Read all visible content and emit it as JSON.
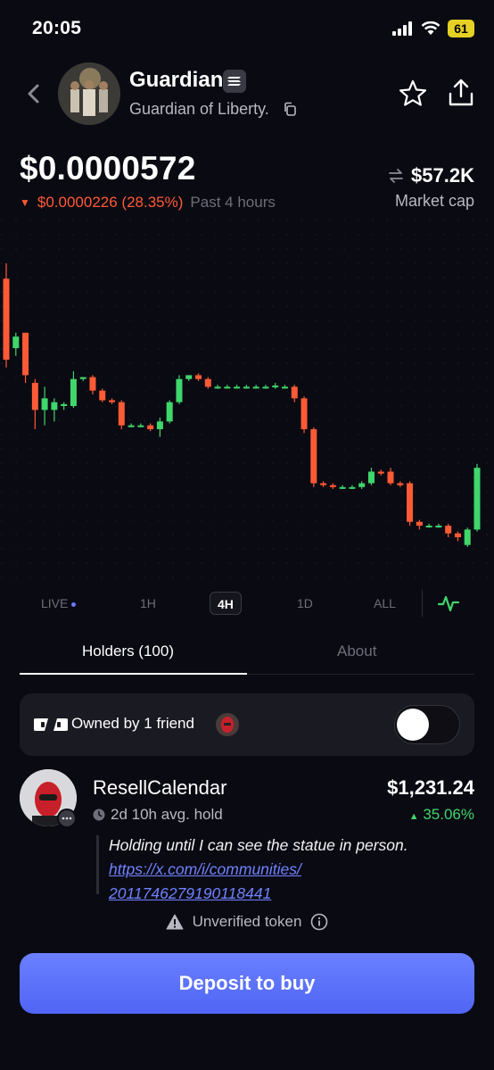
{
  "status_bar": {
    "time": "20:05",
    "battery": "61"
  },
  "token": {
    "name": "Guardian",
    "subtitle": "Guardian of Liberty.",
    "price": "$0.0000572",
    "change": "$0.0000226 (28.35%)",
    "period": "Past 4 hours",
    "market_cap": "$57.2K",
    "market_cap_label": "Market cap"
  },
  "timeframes": [
    "LIVE",
    "1H",
    "4H",
    "1D",
    "ALL"
  ],
  "active_timeframe": "4H",
  "tabs": {
    "holders": "Holders (100)",
    "about": "About"
  },
  "friends": {
    "label": "Owned by 1 friend",
    "toggle_on": false
  },
  "holder": {
    "name": "ResellCalendar",
    "value": "$1,231.24",
    "change": "35.06%",
    "hold": "2d 10h avg. hold",
    "quote": "Holding until I can see the statue in person.",
    "link_line1": "https://x.com/i/communities/",
    "link_line2": "2011746279190118441"
  },
  "unverified_label": "Unverified token",
  "deposit_label": "Deposit to buy",
  "colors": {
    "up": "#3fd66c",
    "down": "#ff5a36",
    "accent": "#5c72fb",
    "background": "#0a0a12"
  },
  "chart_data": {
    "type": "candlestick",
    "candles": [
      {
        "o": 78,
        "h": 82,
        "l": 55,
        "c": 57
      },
      {
        "o": 60,
        "h": 64,
        "l": 58,
        "c": 63
      },
      {
        "o": 64,
        "h": 64,
        "l": 51,
        "c": 53
      },
      {
        "o": 51,
        "h": 52,
        "l": 39,
        "c": 44
      },
      {
        "o": 44,
        "h": 50,
        "l": 40,
        "c": 47
      },
      {
        "o": 44,
        "h": 47,
        "l": 41,
        "c": 46
      },
      {
        "o": 45,
        "h": 46,
        "l": 44,
        "c": 45.5
      },
      {
        "o": 45,
        "h": 54,
        "l": 44.5,
        "c": 52
      },
      {
        "o": 52,
        "h": 52.5,
        "l": 51.5,
        "c": 52.5
      },
      {
        "o": 52.5,
        "h": 53,
        "l": 48,
        "c": 49
      },
      {
        "o": 49,
        "h": 49.5,
        "l": 46,
        "c": 46.5
      },
      {
        "o": 46.5,
        "h": 47,
        "l": 45.5,
        "c": 46
      },
      {
        "o": 46,
        "h": 46.5,
        "l": 39,
        "c": 40
      },
      {
        "o": 40,
        "h": 40.5,
        "l": 39.5,
        "c": 40
      },
      {
        "o": 40,
        "h": 40.5,
        "l": 39.5,
        "c": 40
      },
      {
        "o": 40,
        "h": 40.5,
        "l": 38.5,
        "c": 39
      },
      {
        "o": 39,
        "h": 42,
        "l": 37,
        "c": 41
      },
      {
        "o": 41,
        "h": 46.5,
        "l": 40.5,
        "c": 46
      },
      {
        "o": 46,
        "h": 53,
        "l": 45.5,
        "c": 52
      },
      {
        "o": 52,
        "h": 53,
        "l": 51.5,
        "c": 53
      },
      {
        "o": 53,
        "h": 53.5,
        "l": 51.5,
        "c": 52
      },
      {
        "o": 52,
        "h": 52.5,
        "l": 49.5,
        "c": 50
      },
      {
        "o": 50,
        "h": 50.5,
        "l": 49.5,
        "c": 50
      },
      {
        "o": 50,
        "h": 50.5,
        "l": 49.5,
        "c": 50
      },
      {
        "o": 50,
        "h": 50.5,
        "l": 49.5,
        "c": 50
      },
      {
        "o": 50,
        "h": 50.5,
        "l": 49.5,
        "c": 50
      },
      {
        "o": 50,
        "h": 50.5,
        "l": 49.5,
        "c": 50
      },
      {
        "o": 50,
        "h": 50.5,
        "l": 49.5,
        "c": 50
      },
      {
        "o": 50,
        "h": 51,
        "l": 49.5,
        "c": 50.3
      },
      {
        "o": 50,
        "h": 50.5,
        "l": 49.5,
        "c": 50
      },
      {
        "o": 50,
        "h": 50.5,
        "l": 46,
        "c": 47
      },
      {
        "o": 47,
        "h": 47.5,
        "l": 38,
        "c": 39
      },
      {
        "o": 39,
        "h": 39.5,
        "l": 24,
        "c": 25
      },
      {
        "o": 25,
        "h": 25.5,
        "l": 24,
        "c": 24.5
      },
      {
        "o": 24.5,
        "h": 25,
        "l": 23.5,
        "c": 24
      },
      {
        "o": 24,
        "h": 24.5,
        "l": 23.5,
        "c": 24
      },
      {
        "o": 24,
        "h": 24.5,
        "l": 23.5,
        "c": 24
      },
      {
        "o": 24,
        "h": 25.5,
        "l": 23.5,
        "c": 25
      },
      {
        "o": 25,
        "h": 29,
        "l": 24.5,
        "c": 28
      },
      {
        "o": 28,
        "h": 28.5,
        "l": 27,
        "c": 27.5
      },
      {
        "o": 28,
        "h": 29,
        "l": 24.5,
        "c": 25
      },
      {
        "o": 25,
        "h": 25.5,
        "l": 24,
        "c": 24.5
      },
      {
        "o": 25,
        "h": 25.5,
        "l": 14,
        "c": 15
      },
      {
        "o": 15,
        "h": 15.5,
        "l": 13,
        "c": 14
      },
      {
        "o": 14,
        "h": 14.5,
        "l": 13.5,
        "c": 14
      },
      {
        "o": 14,
        "h": 14.5,
        "l": 13.5,
        "c": 14
      },
      {
        "o": 14,
        "h": 14.5,
        "l": 11,
        "c": 12
      },
      {
        "o": 12,
        "h": 12.5,
        "l": 10,
        "c": 11
      },
      {
        "o": 9,
        "h": 13.5,
        "l": 8.5,
        "c": 13
      },
      {
        "o": 13,
        "h": 30,
        "l": 12.5,
        "c": 29
      }
    ]
  }
}
